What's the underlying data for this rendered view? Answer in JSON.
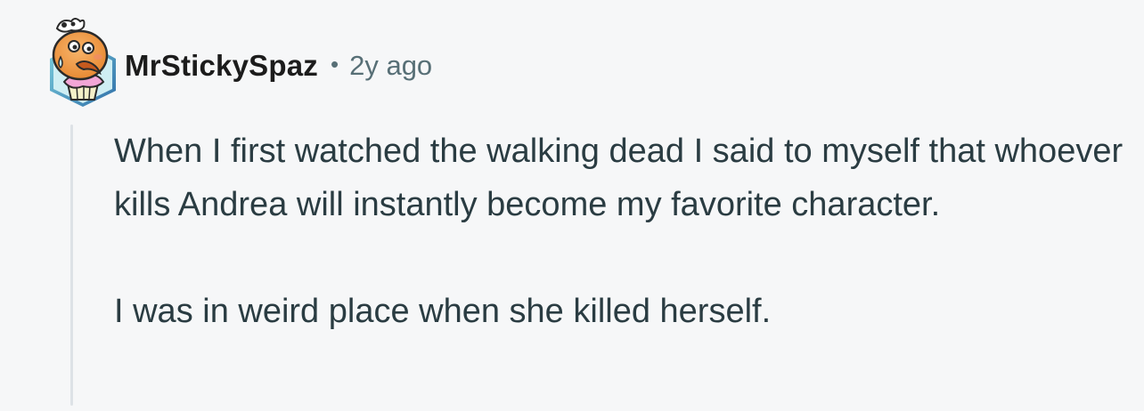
{
  "comment": {
    "author": "MrStickySpaz",
    "separator": "•",
    "timestamp": "2y ago",
    "paragraphs": [
      "When I first watched the walking dead I said to myself that whoever kills Andrea will instantly become my favorite character.",
      "I was in weird place when she killed herself."
    ],
    "avatar_icon": "snoo-muffin-avatar-icon"
  },
  "colors": {
    "background": "#f6f7f8",
    "username": "#1c1c1c",
    "meta": "#576f76",
    "body": "#2a3c42",
    "thread_line": "#dde2e6",
    "avatar_frame": "#3e87b5"
  }
}
